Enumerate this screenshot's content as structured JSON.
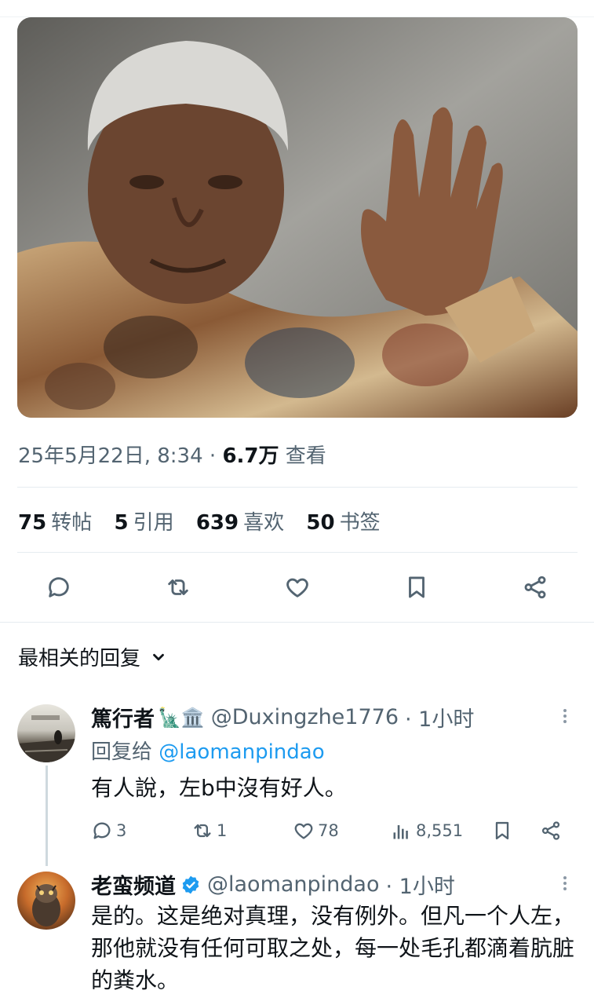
{
  "post": {
    "image_alt": "",
    "date": "25年5月22日, 8:34",
    "separator": "·",
    "views_count": "6.7万",
    "views_label": "查看"
  },
  "stats": [
    {
      "count": "75",
      "label": "转帖"
    },
    {
      "count": "5",
      "label": "引用"
    },
    {
      "count": "639",
      "label": "喜欢"
    },
    {
      "count": "50",
      "label": "书签"
    }
  ],
  "actions": {
    "icons": [
      "reply-icon",
      "repost-icon",
      "like-icon",
      "bookmark-icon",
      "share-icon"
    ]
  },
  "replies_sort": {
    "label": "最相关的回复"
  },
  "replies": [
    {
      "name": "篤行者",
      "emojis": "🗽🏛️",
      "handle": "@Duxingzhe1776",
      "time": "· 1小时",
      "replying_prefix": "回复给 ",
      "replying_to": "@laomanpindao",
      "text": "有人說，左b中沒有好人。",
      "reply_count": "3",
      "repost_count": "1",
      "like_count": "78",
      "view_count": "8,551"
    },
    {
      "name": "老蛮频道",
      "verified": true,
      "handle": "@laomanpindao",
      "time": "· 1小时",
      "text": "是的。这是绝对真理，没有例外。但凡一个人左，那他就没有任何可取之处，每一处毛孔都滴着肮脏的粪水。"
    }
  ],
  "colors": {
    "text": "#0f1419",
    "secondary": "#536471",
    "accent": "#1d9bf0",
    "divider": "#e6ecf0"
  }
}
